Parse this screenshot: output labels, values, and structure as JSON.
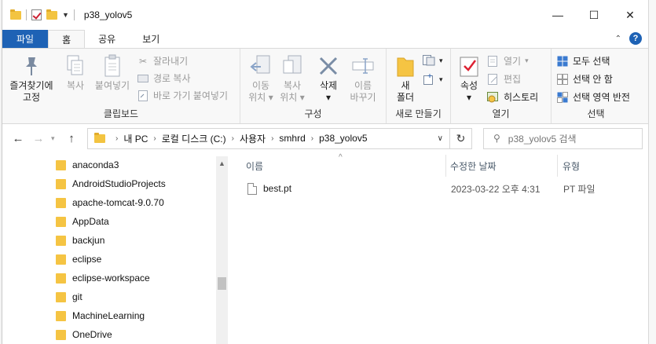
{
  "window": {
    "title": "p38_yolov5"
  },
  "controls": {
    "minimize": "—",
    "maximize": "☐",
    "close": "✕"
  },
  "tabs": [
    "파일",
    "홈",
    "공유",
    "보기"
  ],
  "ribbon": {
    "clipboard": {
      "label": "클립보드",
      "pin": [
        "즐겨찾기에",
        "고정"
      ],
      "copy": "복사",
      "paste": "붙여넣기",
      "cut": "잘라내기",
      "copy_path": "경로 복사",
      "paste_shortcut": "바로 가기 붙여넣기"
    },
    "organize": {
      "label": "구성",
      "move_to": [
        "이동",
        "위치"
      ],
      "copy_to": [
        "복사",
        "위치"
      ],
      "delete": "삭제",
      "rename": [
        "이름",
        "바꾸기"
      ]
    },
    "new": {
      "label": "새로 만들기",
      "new_folder": [
        "새",
        "폴더"
      ]
    },
    "open": {
      "label": "열기",
      "properties": "속성",
      "open": "열기",
      "edit": "편집",
      "history": "히스토리"
    },
    "select": {
      "label": "선택",
      "select_all": "모두 선택",
      "select_none": "선택 안 함",
      "invert": "선택 영역 반전"
    }
  },
  "address": {
    "crumbs": [
      "내 PC",
      "로컬 디스크 (C:)",
      "사용자",
      "smhrd",
      "p38_yolov5"
    ],
    "search_placeholder": "p38_yolov5 검색"
  },
  "tree": [
    "anaconda3",
    "AndroidStudioProjects",
    "apache-tomcat-9.0.70",
    "AppData",
    "backjun",
    "eclipse",
    "eclipse-workspace",
    "git",
    "MachineLearning",
    "OneDrive"
  ],
  "columns": {
    "name": "이름",
    "modified": "수정한 날짜",
    "type": "유형"
  },
  "files": [
    {
      "name": "best.pt",
      "modified": "2023-03-22 오후 4:31",
      "type": "PT 파일"
    }
  ],
  "colors": {
    "accent": "#1e62b5",
    "folder": "#f3c441"
  }
}
